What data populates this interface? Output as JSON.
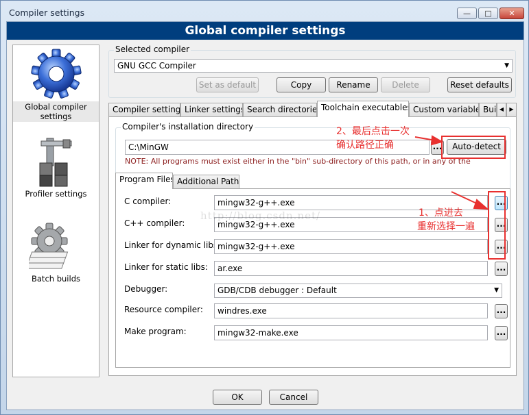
{
  "window": {
    "title": "Compiler settings",
    "banner": "Global compiler settings"
  },
  "categories": [
    {
      "label": "Global compiler settings",
      "icon": "gear-icon",
      "selected": true
    },
    {
      "label": "Profiler settings",
      "icon": "profiler-icon",
      "selected": false
    },
    {
      "label": "Batch builds",
      "icon": "batch-builds-icon",
      "selected": false
    }
  ],
  "selected_compiler": {
    "label": "Selected compiler",
    "value": "GNU GCC Compiler"
  },
  "compiler_buttons": {
    "set_default": "Set as default",
    "copy": "Copy",
    "rename": "Rename",
    "delete": "Delete",
    "reset": "Reset defaults"
  },
  "tabs": [
    "Compiler settings",
    "Linker settings",
    "Search directories",
    "Toolchain executables",
    "Custom variables",
    "Bui"
  ],
  "install_dir": {
    "label": "Compiler's installation directory",
    "value": "C:\\MinGW",
    "browse": "...",
    "autodetect": "Auto-detect",
    "note": "NOTE: All programs must exist either in the \"bin\" sub-directory of this path, or in any of the"
  },
  "subtabs": [
    "Program Files",
    "Additional Paths"
  ],
  "programs": [
    {
      "label": "C compiler:",
      "value": "mingw32-g++.exe",
      "type": "input"
    },
    {
      "label": "C++ compiler:",
      "value": "mingw32-g++.exe",
      "type": "input"
    },
    {
      "label": "Linker for dynamic libs:",
      "value": "mingw32-g++.exe",
      "type": "input"
    },
    {
      "label": "Linker for static libs:",
      "value": "ar.exe",
      "type": "input"
    },
    {
      "label": "Debugger:",
      "value": "GDB/CDB debugger : Default",
      "type": "select"
    },
    {
      "label": "Resource compiler:",
      "value": "windres.exe",
      "type": "input"
    },
    {
      "label": "Make program:",
      "value": "mingw32-make.exe",
      "type": "input"
    }
  ],
  "browse_label": "...",
  "dialog_buttons": {
    "ok": "OK",
    "cancel": "Cancel"
  },
  "annotations": {
    "step2_line1": "2、最后点击一次",
    "step2_line2": "确认路径正确",
    "step1_line1": "1、点进去",
    "step1_line2": "重新选择一遍",
    "watermark": "http://blog.csdn.net/"
  },
  "colors": {
    "banner_bg": "#003e7e",
    "annotation_red": "#e8302f"
  }
}
